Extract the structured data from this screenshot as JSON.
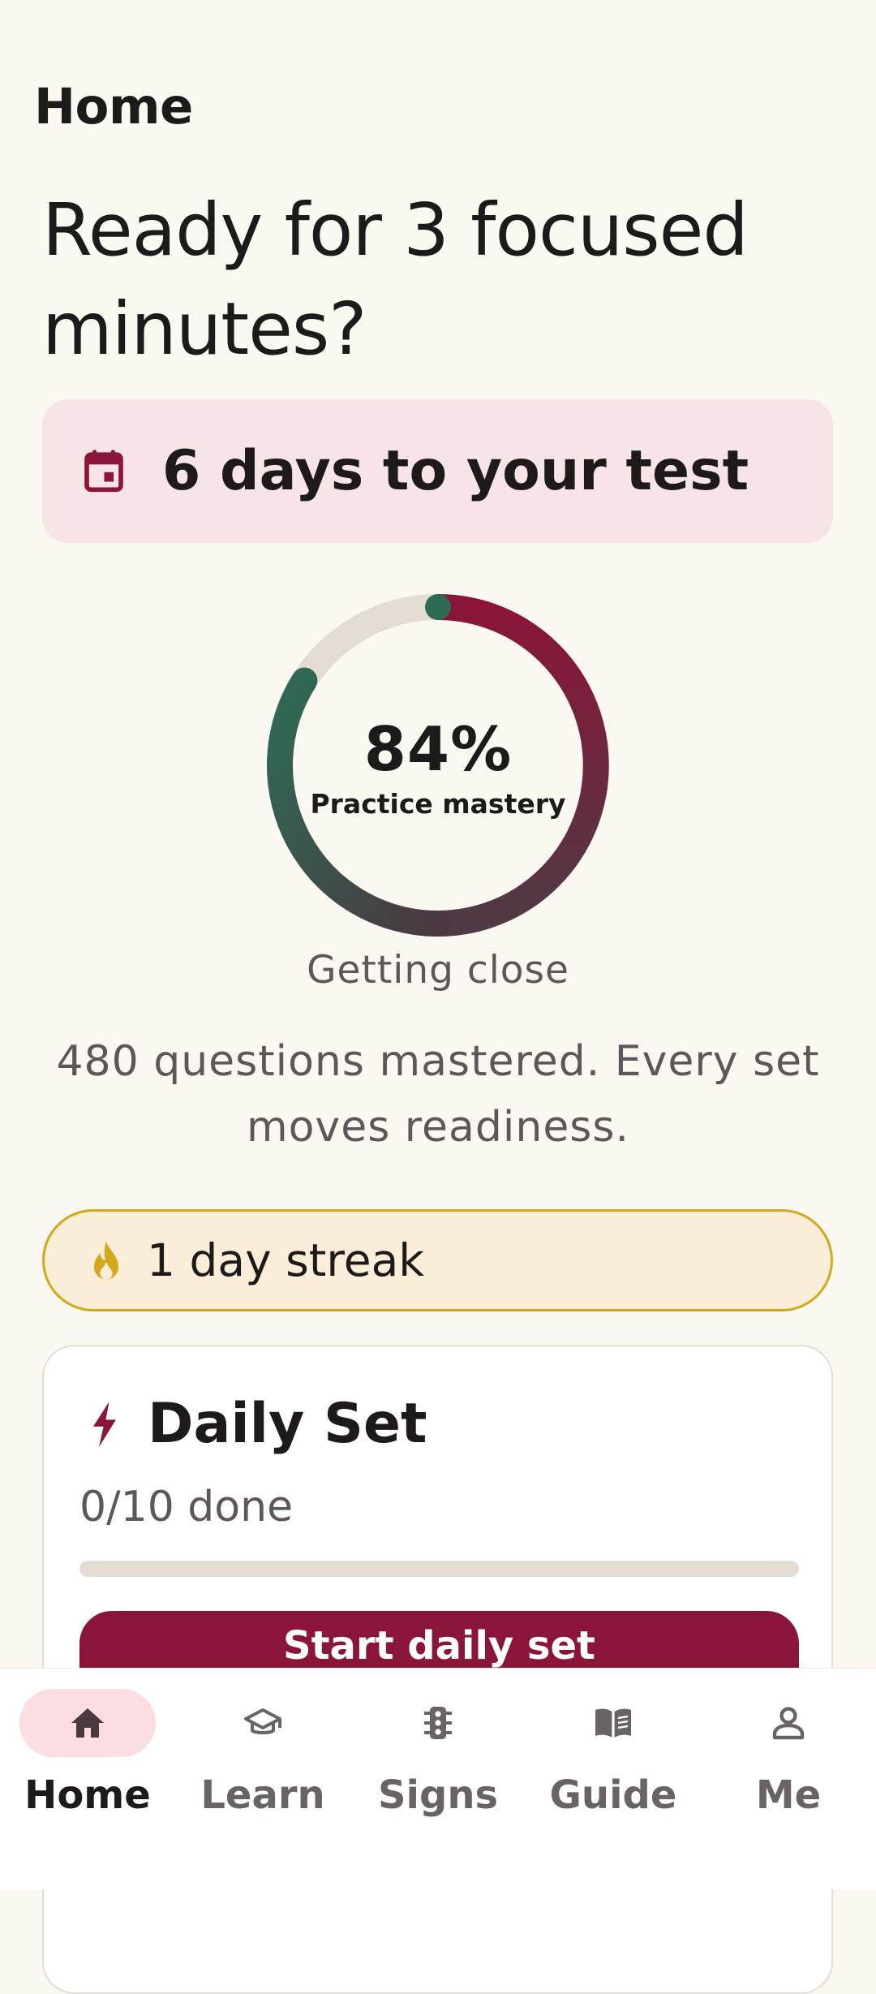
{
  "header": {
    "title": "Home"
  },
  "hero": {
    "line1": "Ready for 3 focused",
    "line2": "minutes?"
  },
  "countdown": {
    "icon": "calendar-icon",
    "label": "6 days to your test"
  },
  "mastery": {
    "percent": 84,
    "percent_text": "84%",
    "label": "Practice mastery",
    "status": "Getting close",
    "colors": {
      "start": "#8B1538",
      "end": "#2E6B55",
      "track": "#E3DDD3"
    }
  },
  "summary": {
    "line1": "480 questions mastered. Every set",
    "line2": "moves readiness."
  },
  "streak": {
    "icon": "flame-icon",
    "label": "1 day streak",
    "color": "#D4A81B"
  },
  "daily_set": {
    "icon": "bolt-icon",
    "title": "Daily Set",
    "progress_text": "0/10 done",
    "progress_fraction": 0,
    "button_label": "Start daily set"
  },
  "nav": {
    "items": [
      {
        "label": "Home",
        "icon": "home-icon",
        "active": true
      },
      {
        "label": "Learn",
        "icon": "graduation-cap-icon",
        "active": false
      },
      {
        "label": "Signs",
        "icon": "traffic-light-icon",
        "active": false
      },
      {
        "label": "Guide",
        "icon": "book-icon",
        "active": false
      },
      {
        "label": "Me",
        "icon": "person-icon",
        "active": false
      }
    ]
  },
  "theme": {
    "accent": "#8B1538",
    "background": "#FBF8F1"
  }
}
